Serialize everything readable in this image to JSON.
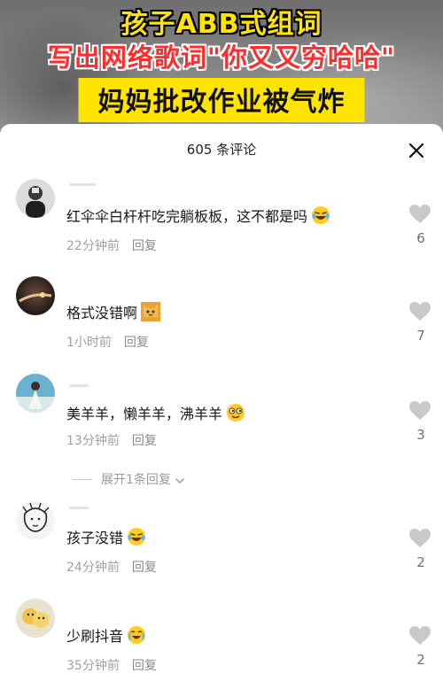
{
  "video": {
    "headline_1": "孩子ABB式组词",
    "headline_2": "写出网络歌词\"你又又穷哈哈\"",
    "headline_3": "妈妈批改作业被气炸"
  },
  "sheet": {
    "comment_count": "605 条评论",
    "close_icon": "close-icon"
  },
  "comments": [
    {
      "text": "红伞伞白杆杆吃完躺板板，这不都是吗",
      "emoji": "rofl-emoji",
      "time": "22分钟前",
      "reply": "回复",
      "likes": "6"
    },
    {
      "text": "格式没错啊",
      "emoji": "cat-emoji",
      "time": "1小时前",
      "reply": "回复",
      "likes": "7"
    },
    {
      "text": "美羊羊，懒羊羊，沸羊羊",
      "emoji": "smirk-emoji",
      "time": "13分钟前",
      "reply": "回复",
      "likes": "3"
    },
    {
      "text": "孩子没错",
      "emoji": "rofl-emoji",
      "time": "24分钟前",
      "reply": "回复",
      "likes": "2"
    },
    {
      "text": "少刷抖音",
      "emoji": "laugh-cry-emoji",
      "time": "35分钟前",
      "reply": "回复",
      "likes": "2"
    }
  ],
  "expand_replies": "展开1条回复",
  "colors": {
    "headline_yellow": "#ffe400",
    "headline_red": "#ff2d2d",
    "meta_gray": "#a0a0a0"
  }
}
